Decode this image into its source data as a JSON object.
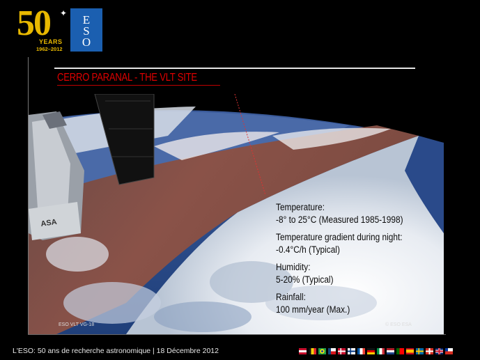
{
  "logo": {
    "number": "50",
    "years": "YEARS",
    "range": "1962–2012",
    "eso_letters": [
      "E",
      "S",
      "O"
    ]
  },
  "slide": {
    "title": "CERRO PARANAL - THE VLT SITE",
    "info": [
      {
        "label": "Temperature:",
        "value": "-8° to 25°C (Measured 1985-1998)"
      },
      {
        "label": "Temperature gradient during night:",
        "value": "-0.4°C/h (Typical)"
      },
      {
        "label": "Humidity:",
        "value": "5-20% (Typical)"
      },
      {
        "label": "Rainfall:",
        "value": "100 mm/year (Max.)"
      }
    ],
    "credit_left": "ESO VLT VG-18",
    "credit_right": "© ESO ESA"
  },
  "footer": {
    "text": "L'ESO: 50 ans de recherche astronomique | 18 Décembre 2012"
  },
  "flags": [
    {
      "name": "austria",
      "colors": [
        "#c8102e",
        "#ffffff",
        "#c8102e"
      ],
      "layout": "h"
    },
    {
      "name": "belgium",
      "colors": [
        "#111111",
        "#f5d20a",
        "#e0202e"
      ],
      "layout": "v"
    },
    {
      "name": "brazil",
      "colors": [
        "#229e45",
        "#f8e509",
        "#2b49a3"
      ],
      "layout": "br"
    },
    {
      "name": "czech",
      "colors": [
        "#ffffff",
        "#d7141a",
        "#11457e"
      ],
      "layout": "cz"
    },
    {
      "name": "denmark",
      "colors": [
        "#c8102e",
        "#ffffff"
      ],
      "layout": "nordic"
    },
    {
      "name": "finland",
      "colors": [
        "#ffffff",
        "#003580"
      ],
      "layout": "nordic"
    },
    {
      "name": "france",
      "colors": [
        "#0055a4",
        "#ffffff",
        "#ef4135"
      ],
      "layout": "v"
    },
    {
      "name": "germany",
      "colors": [
        "#111111",
        "#dd0000",
        "#ffce00"
      ],
      "layout": "h"
    },
    {
      "name": "italy",
      "colors": [
        "#009246",
        "#ffffff",
        "#ce2b37"
      ],
      "layout": "v"
    },
    {
      "name": "netherlands",
      "colors": [
        "#ae1c28",
        "#ffffff",
        "#21468b"
      ],
      "layout": "h"
    },
    {
      "name": "portugal",
      "colors": [
        "#006600",
        "#ff0000"
      ],
      "layout": "pt"
    },
    {
      "name": "spain",
      "colors": [
        "#c60b1e",
        "#ffc400",
        "#c60b1e"
      ],
      "layout": "es"
    },
    {
      "name": "sweden",
      "colors": [
        "#006aa7",
        "#fecc00"
      ],
      "layout": "nordic"
    },
    {
      "name": "switzerland",
      "colors": [
        "#d52b1e",
        "#ffffff"
      ],
      "layout": "ch"
    },
    {
      "name": "united-kingdom",
      "colors": [
        "#012169",
        "#ffffff",
        "#c8102e"
      ],
      "layout": "uk"
    },
    {
      "name": "chile",
      "colors": [
        "#ffffff",
        "#d52b1e",
        "#0039a6"
      ],
      "layout": "cl"
    }
  ]
}
